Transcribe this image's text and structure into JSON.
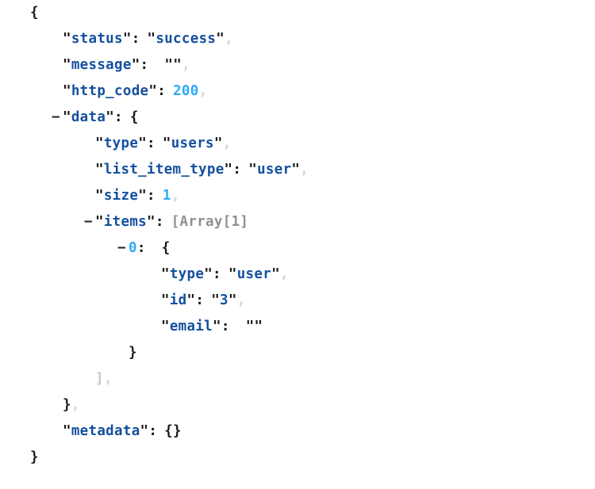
{
  "viewer": {
    "name": "json-tree-viewer",
    "colors": {
      "key": "#14509f",
      "string": "#14509f",
      "number": "#2eaaf5",
      "punctuation": "#1a1a1a",
      "comma": "#d3d3d3",
      "meta": "#909090",
      "background": "#ffffff"
    }
  },
  "tokens": {
    "open_brace": "{",
    "close_brace": "}",
    "close_bracket": "]",
    "empty_object": "{}",
    "empty_string": "\"\"",
    "quote": "\"",
    "colon": ":",
    "comma": ",",
    "collapse": "−"
  },
  "lines": {
    "root_open": {
      "brace": "{"
    },
    "status": {
      "key": "status",
      "value": "success",
      "comma": ","
    },
    "message": {
      "key": "message",
      "value": "\"\"",
      "comma": ","
    },
    "http_code": {
      "key": "http_code",
      "value": "200",
      "comma": ","
    },
    "data": {
      "toggle": "−",
      "key": "data",
      "brace": "{"
    },
    "type": {
      "key": "type",
      "value": "users",
      "comma": ","
    },
    "list_item_type": {
      "key": "list_item_type",
      "value": "user",
      "comma": ","
    },
    "size": {
      "key": "size",
      "value": "1",
      "comma": ","
    },
    "items": {
      "toggle": "−",
      "key": "items",
      "meta": "[Array[1]"
    },
    "item_0": {
      "toggle": "−",
      "index": "0",
      "colon": ":",
      "brace": "{"
    },
    "item_type": {
      "key": "type",
      "value": "user",
      "comma": ","
    },
    "item_id": {
      "key": "id",
      "value": "3",
      "comma": ","
    },
    "item_email": {
      "key": "email",
      "value": "\"\""
    },
    "item_close": {
      "brace": "}"
    },
    "items_close": {
      "bracket": "]",
      "comma": ","
    },
    "data_close": {
      "brace": "}",
      "comma": ","
    },
    "metadata": {
      "key": "metadata",
      "value": "{}"
    },
    "root_close": {
      "brace": "}"
    }
  },
  "json_content": {
    "status": "success",
    "message": "",
    "http_code": 200,
    "data": {
      "type": "users",
      "list_item_type": "user",
      "size": 1,
      "items": [
        {
          "type": "user",
          "id": "3",
          "email": ""
        }
      ]
    },
    "metadata": {}
  }
}
